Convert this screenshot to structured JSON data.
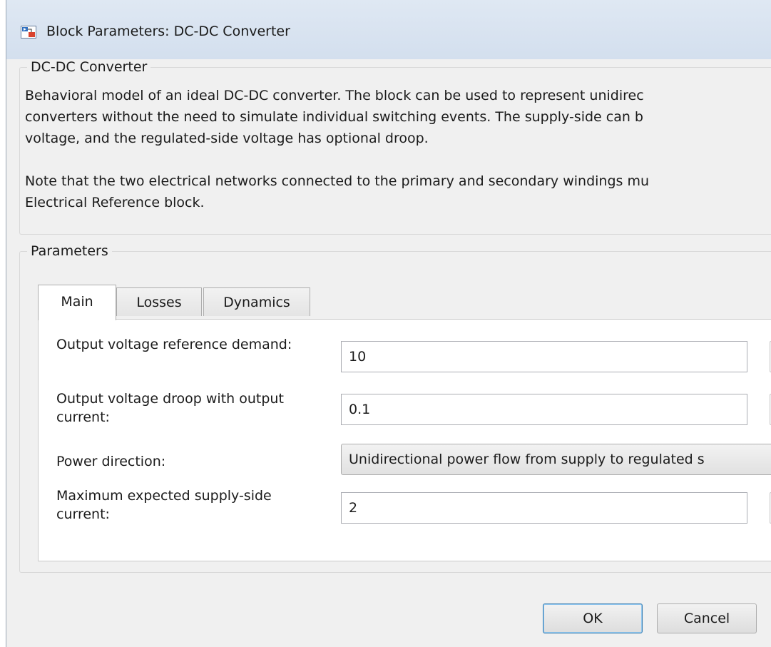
{
  "window": {
    "title": "Block Parameters: DC-DC Converter"
  },
  "description": {
    "legend": "DC-DC Converter",
    "lines": [
      "Behavioral model of an ideal DC-DC converter. The block can be used to represent unidirec",
      "converters without the need to simulate individual switching events. The supply-side can b",
      "voltage, and the regulated-side voltage has optional droop.",
      "Note that the two electrical networks connected to the primary and secondary windings mu",
      "Electrical Reference block."
    ]
  },
  "parameters": {
    "legend": "Parameters",
    "tabs": [
      {
        "label": "Main",
        "active": true
      },
      {
        "label": "Losses",
        "active": false
      },
      {
        "label": "Dynamics",
        "active": false
      }
    ],
    "fields": {
      "output_voltage_reference": {
        "label": "Output voltage reference demand:",
        "value": "10"
      },
      "output_voltage_droop": {
        "label": "Output voltage droop with output current:",
        "value": "0.1"
      },
      "power_direction": {
        "label": "Power direction:",
        "value": "Unidirectional power flow from supply to regulated s"
      },
      "max_supply_current": {
        "label": "Maximum expected supply-side current:",
        "value": "2"
      }
    }
  },
  "buttons": {
    "ok": "OK",
    "cancel": "Cancel"
  }
}
